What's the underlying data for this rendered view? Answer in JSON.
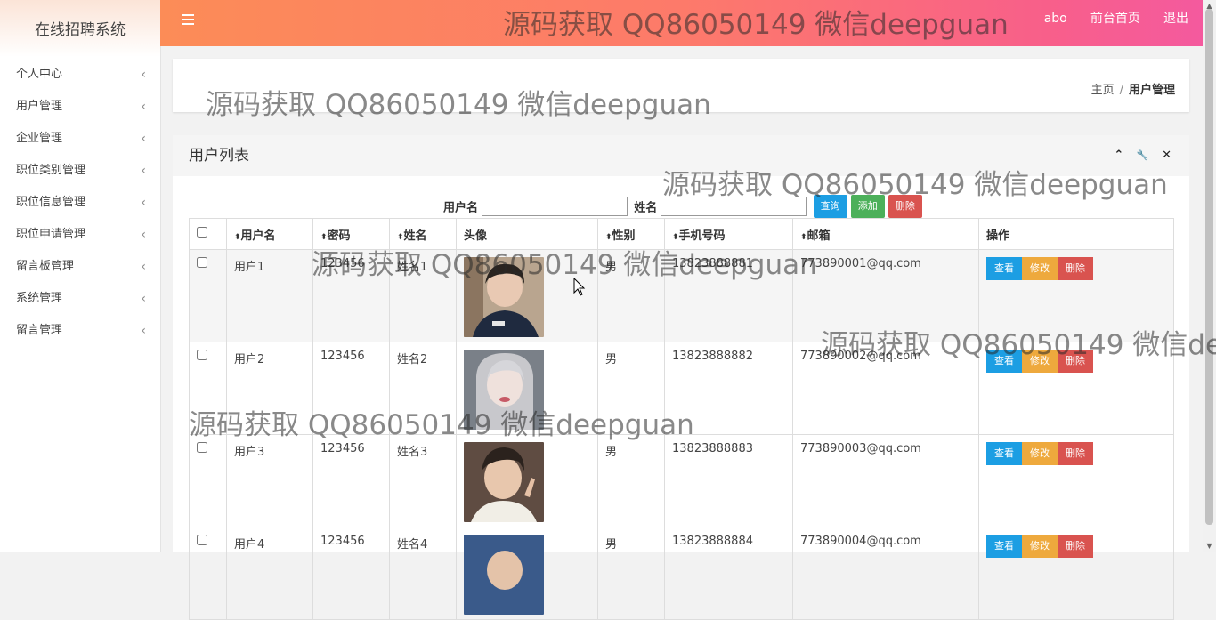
{
  "app": {
    "title": "在线招聘系统"
  },
  "sidebar": {
    "items": [
      {
        "label": "个人中心"
      },
      {
        "label": "用户管理"
      },
      {
        "label": "企业管理"
      },
      {
        "label": "职位类别管理"
      },
      {
        "label": "职位信息管理"
      },
      {
        "label": "职位申请管理"
      },
      {
        "label": "留言板管理"
      },
      {
        "label": "系统管理"
      },
      {
        "label": "留言管理"
      }
    ],
    "chevron": "‹"
  },
  "topbar": {
    "menu_icon": "hamburger-icon",
    "user": "abo",
    "home_link": "前台首页",
    "logout_link": "退出",
    "gradient": [
      "#fc8c57",
      "#f45a9e"
    ]
  },
  "breadcrumb": {
    "home": "主页",
    "separator": "/",
    "current": "用户管理"
  },
  "panel": {
    "title": "用户列表",
    "tools": {
      "collapse": "⌃",
      "config": "🔧",
      "close": "✕"
    }
  },
  "search": {
    "username_label": "用户名",
    "name_label": "姓名",
    "username_value": "",
    "name_value": "",
    "query_button": "查询",
    "add_button": "添加",
    "delete_button": "删除"
  },
  "table": {
    "columns": [
      "用户名",
      "密码",
      "姓名",
      "头像",
      "性别",
      "手机号码",
      "邮箱",
      "操作"
    ],
    "sort_icon": "⬍",
    "rows": [
      {
        "username": "用户1",
        "password": "123456",
        "name": "姓名1",
        "gender": "男",
        "phone": "13823888881",
        "email": "773890001@qq.com"
      },
      {
        "username": "用户2",
        "password": "123456",
        "name": "姓名2",
        "gender": "男",
        "phone": "13823888882",
        "email": "773890002@qq.com"
      },
      {
        "username": "用户3",
        "password": "123456",
        "name": "姓名3",
        "gender": "男",
        "phone": "13823888883",
        "email": "773890003@qq.com"
      },
      {
        "username": "用户4",
        "password": "123456",
        "name": "姓名4",
        "gender": "男",
        "phone": "13823888884",
        "email": "773890004@qq.com"
      }
    ],
    "actions": {
      "view": "查看",
      "edit": "修改",
      "delete": "删除"
    }
  },
  "watermark": {
    "text": "源码获取 QQ86050149 微信deepguan"
  },
  "colors": {
    "blue": "#1c9ee3",
    "green": "#4cb05a",
    "red": "#d9534f",
    "orange": "#eea93d"
  }
}
